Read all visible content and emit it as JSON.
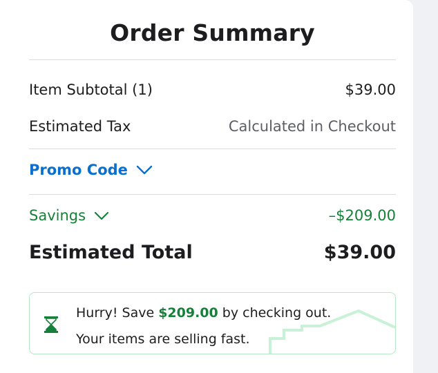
{
  "order_summary": {
    "title": "Order Summary",
    "item_subtotal_label": "Item Subtotal (1)",
    "item_subtotal_value": "$39.00",
    "estimated_tax_label": "Estimated Tax",
    "estimated_tax_value": "Calculated in Checkout",
    "promo_code_label": "Promo Code",
    "savings_label": "Savings",
    "savings_value": "–$209.00",
    "estimated_total_label": "Estimated Total",
    "estimated_total_value": "$39.00"
  },
  "banner": {
    "line1_prefix": "Hurry! Save ",
    "line1_amount": "$209.00",
    "line1_suffix": " by checking out.",
    "line2": "Your items are selling fast.",
    "icon": "hourglass-icon"
  },
  "colors": {
    "accent_blue": "#0a6fcf",
    "savings_green": "#16803a",
    "banner_border": "#b9e6c8"
  }
}
